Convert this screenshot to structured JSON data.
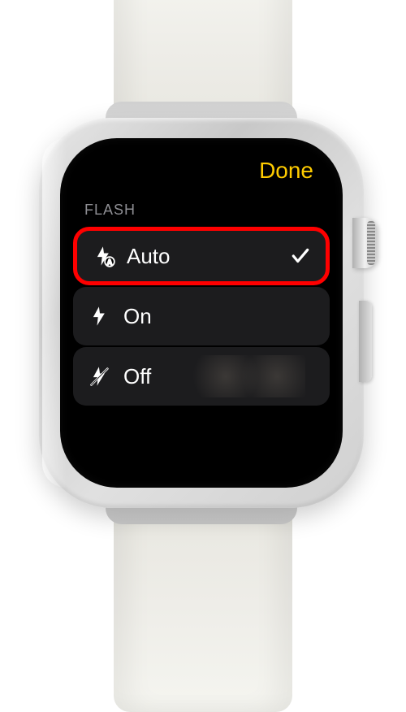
{
  "header": {
    "done_label": "Done"
  },
  "flash_section": {
    "label": "FLASH",
    "options": [
      {
        "icon": "flash-auto-icon",
        "label": "Auto",
        "selected": true,
        "highlighted": true
      },
      {
        "icon": "flash-on-icon",
        "label": "On",
        "selected": false,
        "highlighted": false
      },
      {
        "icon": "flash-off-icon",
        "label": "Off",
        "selected": false,
        "highlighted": false
      }
    ]
  },
  "colors": {
    "accent_yellow": "#ffcc00",
    "highlight_red": "#ff0000",
    "row_background": "#1c1c1e",
    "section_label": "#8e8e93"
  }
}
